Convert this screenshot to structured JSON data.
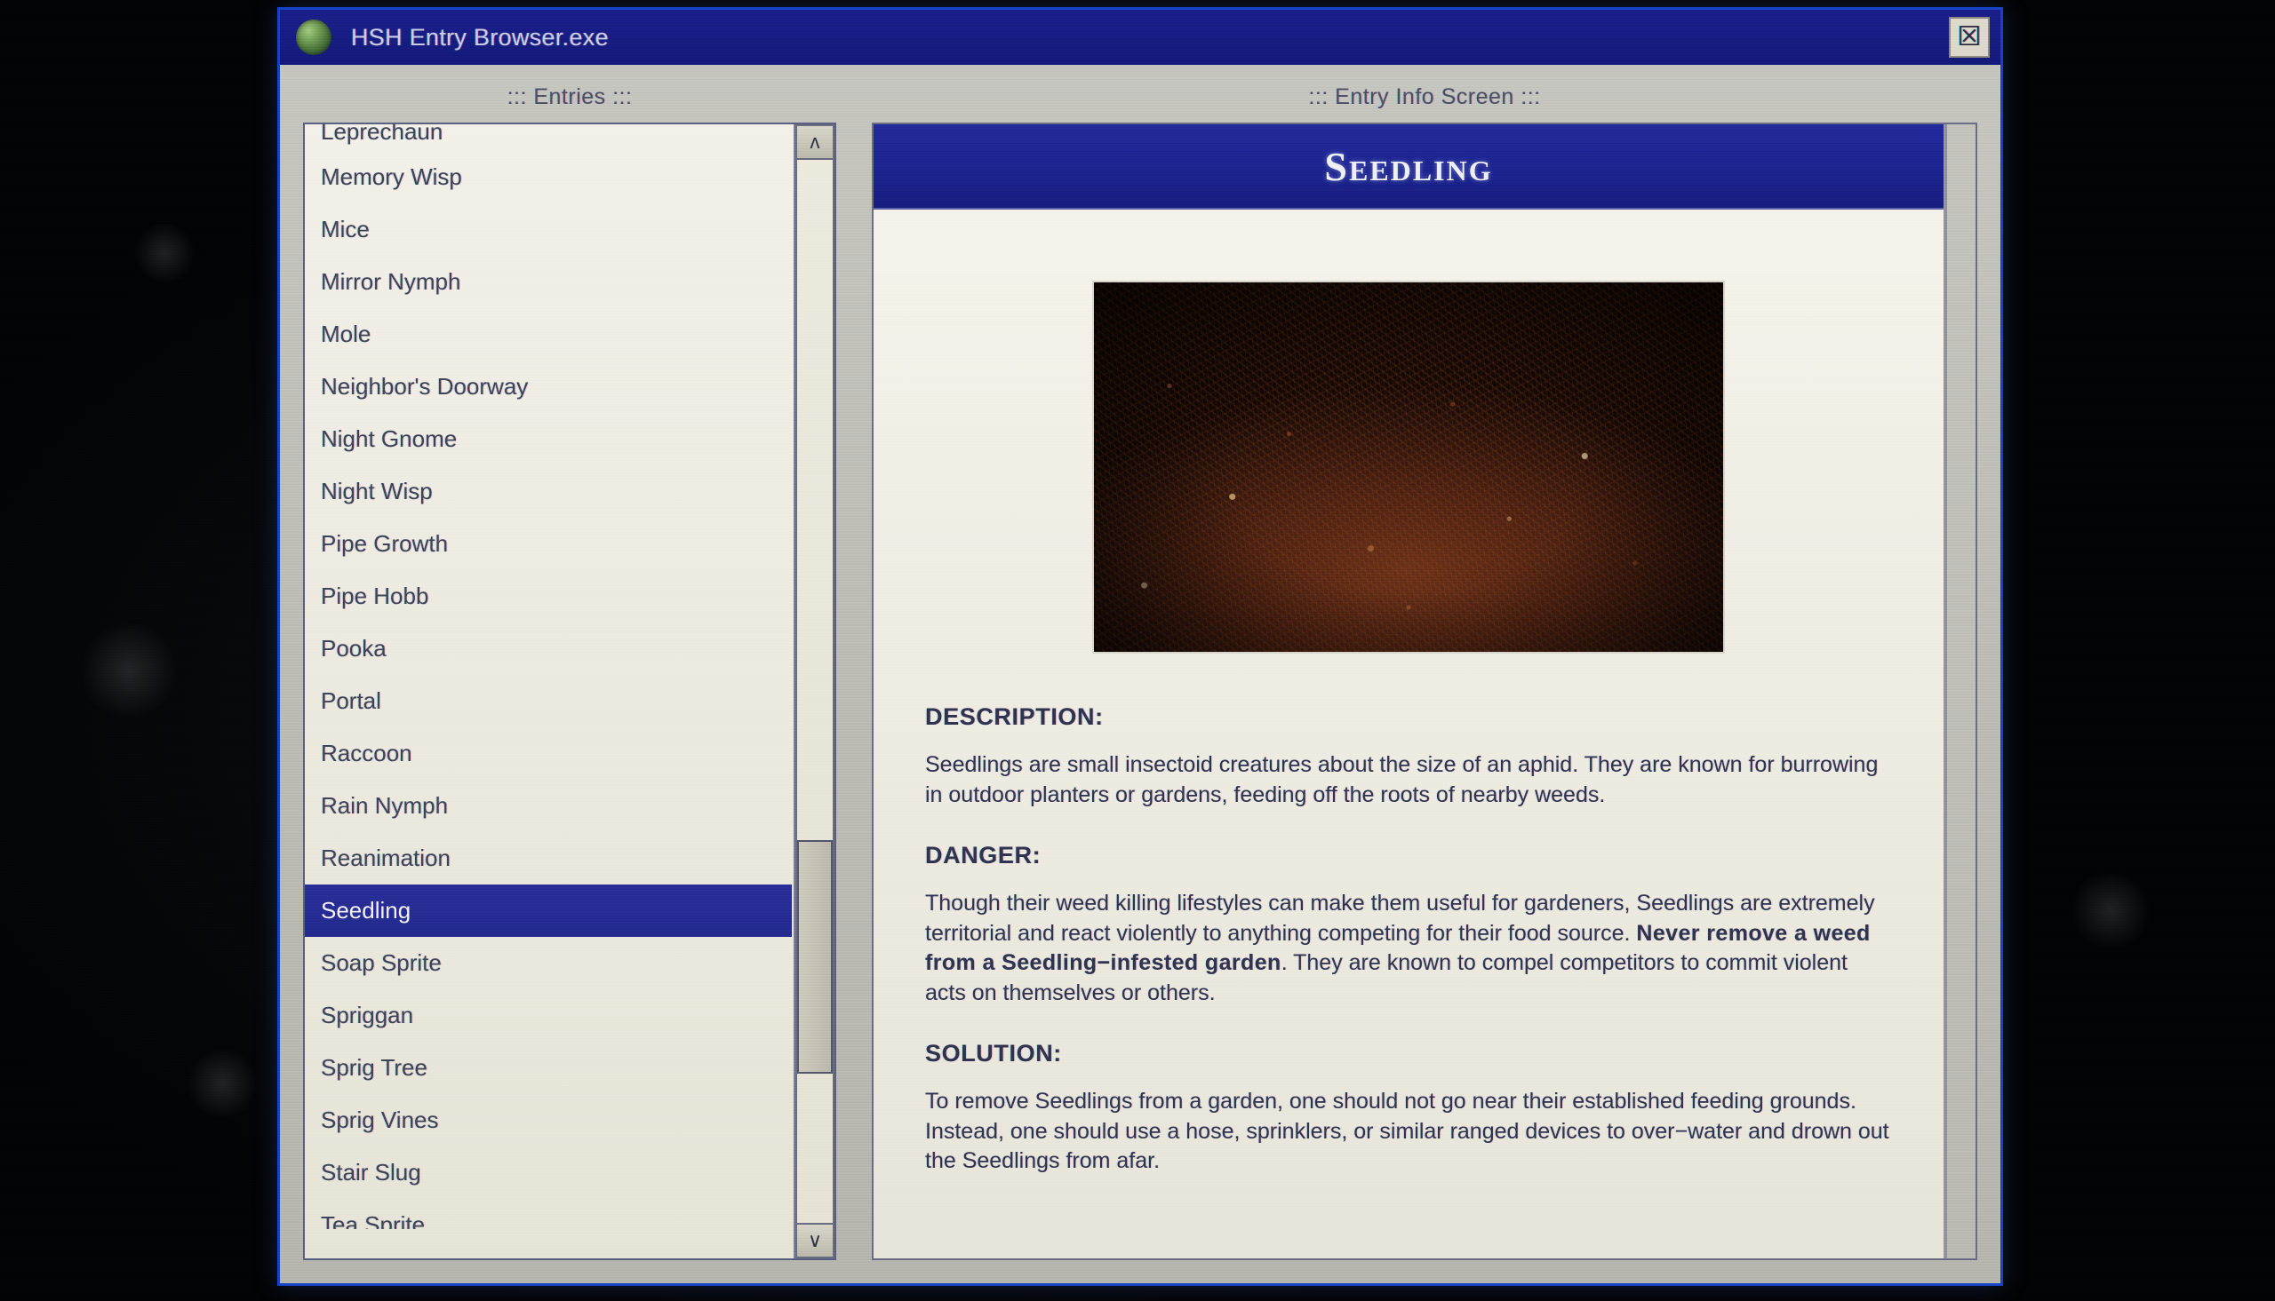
{
  "window": {
    "title": "HSH Entry Browser.exe",
    "app_icon": "globe-icon",
    "close_label": "☒",
    "accent_blue": "#1a1f8a",
    "frame_blue": "#1642c8"
  },
  "entries_panel": {
    "heading": "::: Entries :::",
    "selected": "Seedling",
    "scrollbar": {
      "up_arrow": "ʌ",
      "down_arrow": "∨"
    },
    "items": [
      {
        "label": "Leprechaun",
        "state": "clipped-top"
      },
      {
        "label": "Memory Wisp",
        "state": "normal"
      },
      {
        "label": "Mice",
        "state": "normal"
      },
      {
        "label": "Mirror Nymph",
        "state": "normal"
      },
      {
        "label": "Mole",
        "state": "normal"
      },
      {
        "label": "Neighbor's Doorway",
        "state": "normal"
      },
      {
        "label": "Night Gnome",
        "state": "normal"
      },
      {
        "label": "Night Wisp",
        "state": "normal"
      },
      {
        "label": "Pipe Growth",
        "state": "normal"
      },
      {
        "label": "Pipe Hobb",
        "state": "normal"
      },
      {
        "label": "Pooka",
        "state": "normal"
      },
      {
        "label": "Portal",
        "state": "normal"
      },
      {
        "label": "Raccoon",
        "state": "normal"
      },
      {
        "label": "Rain Nymph",
        "state": "normal"
      },
      {
        "label": "Reanimation",
        "state": "normal"
      },
      {
        "label": "Seedling",
        "state": "selected"
      },
      {
        "label": "Soap Sprite",
        "state": "normal"
      },
      {
        "label": "Spriggan",
        "state": "normal"
      },
      {
        "label": "Sprig Tree",
        "state": "normal"
      },
      {
        "label": "Sprig Vines",
        "state": "normal"
      },
      {
        "label": "Stair Slug",
        "state": "normal"
      },
      {
        "label": "Tea Sprite",
        "state": "clipped-bottom"
      }
    ]
  },
  "info_panel": {
    "heading": "::: Entry Info Screen :::",
    "entry_title": "Seedling",
    "photo_alt": "dark mound of soil and mulch",
    "sections": [
      {
        "label": "DESCRIPTION:",
        "text": "Seedlings are small insectoid creatures about the size of an aphid. They are known for burrowing in outdoor planters or gardens, feeding off the roots of nearby weeds."
      },
      {
        "label": "DANGER:",
        "text_before": "Though their weed killing lifestyles can make them useful for gardeners, Seedlings are extremely territorial and react violently to anything competing for their food source. ",
        "text_bold": "Never remove a weed from a Seedling−infested garden",
        "text_after": ". They are known to compel competitors to commit violent acts on themselves or others."
      },
      {
        "label": "SOLUTION:",
        "text": "To remove Seedlings from a garden, one should not go near their established feeding grounds. Instead, one should use a hose, sprinklers, or similar ranged devices to over−water and drown out the Seedlings from afar."
      }
    ]
  }
}
